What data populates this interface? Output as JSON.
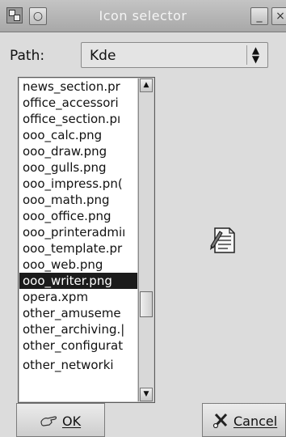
{
  "window": {
    "title": "Icon selector",
    "icon": "window-menu-icon",
    "controls": {
      "shade_icon": "circle-icon",
      "minimize_label": "_",
      "close_label": "×"
    }
  },
  "path": {
    "label": "Path:",
    "value": "Kde",
    "spinner_icon": "up-down-spinner-icon"
  },
  "file_list": {
    "items": [
      "news_section.pr",
      "office_accessori",
      "office_section.pı",
      "ooo_calc.png",
      "ooo_draw.png",
      "ooo_gulls.png",
      "ooo_impress.pn(",
      "ooo_math.png",
      "ooo_office.png",
      "ooo_printeradmiı",
      "ooo_template.pr",
      "ooo_web.png",
      "ooo_writer.png",
      "opera.xpm",
      "other_amuseme",
      "other_archiving.|",
      "other_configurat",
      "other_networki"
    ],
    "selected": "ooo_writer.png",
    "scroll_position": 0.7
  },
  "preview": {
    "icon": "writer-document-icon"
  },
  "buttons": {
    "ok_label": "OK",
    "ok_icon": "hand-pointer-icon",
    "cancel_label": "Cancel",
    "cancel_icon": "scissors-x-icon"
  }
}
